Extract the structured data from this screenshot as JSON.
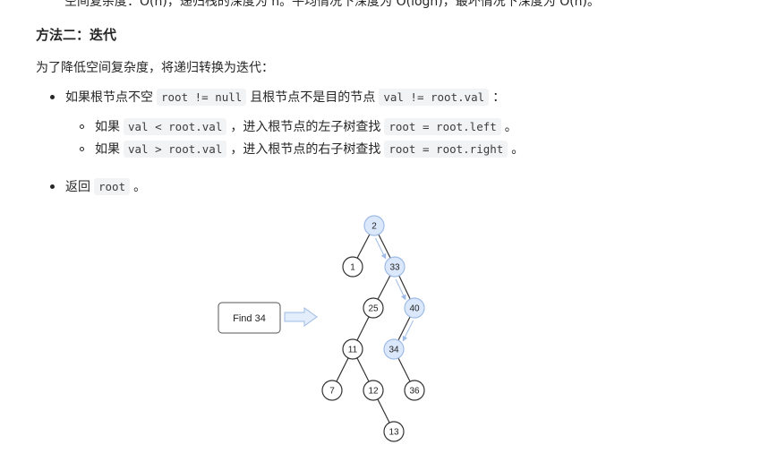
{
  "top_line": "空间复杂度：O(n)，递归栈的深度为 n。平均情况下深度为 O(logn)，最坏情况下深度为 O(n)。",
  "section_title": "方法二：迭代",
  "intro": "为了降低空间复杂度，将递归转换为迭代：",
  "list": {
    "item1": {
      "prefix": "如果根节点不空",
      "code1": "root != null",
      "middle": "且根节点不是目的节点",
      "code2": "val != root.val",
      "suffix": "："
    },
    "sub1": {
      "prefix": "如果",
      "code1": "val < root.val",
      "middle": "，进入根节点的左子树查找",
      "code2": "root = root.left",
      "suffix": "。"
    },
    "sub2": {
      "prefix": "如果",
      "code1": "val > root.val",
      "middle": "，进入根节点的右子树查找",
      "code2": "root = root.right",
      "suffix": "。"
    },
    "item2": {
      "prefix": "返回",
      "code1": "root",
      "suffix": "。"
    }
  },
  "diagram": {
    "find_label": "Find 34",
    "highlight_color": "#dbe8fb",
    "highlight_stroke": "#9fbbe6",
    "node_stroke": "#333333",
    "nodes": [
      {
        "id": "n2",
        "label": "2",
        "highlighted": true
      },
      {
        "id": "n1",
        "label": "1",
        "highlighted": false
      },
      {
        "id": "n33",
        "label": "33",
        "highlighted": true
      },
      {
        "id": "n25",
        "label": "25",
        "highlighted": false
      },
      {
        "id": "n40",
        "label": "40",
        "highlighted": true
      },
      {
        "id": "n11",
        "label": "11",
        "highlighted": false
      },
      {
        "id": "n34",
        "label": "34",
        "highlighted": true
      },
      {
        "id": "n7",
        "label": "7",
        "highlighted": false
      },
      {
        "id": "n12",
        "label": "12",
        "highlighted": false
      },
      {
        "id": "n36",
        "label": "36",
        "highlighted": false
      },
      {
        "id": "n13",
        "label": "13",
        "highlighted": false
      }
    ],
    "edges": [
      [
        "n2",
        "n1"
      ],
      [
        "n2",
        "n33"
      ],
      [
        "n33",
        "n25"
      ],
      [
        "n33",
        "n40"
      ],
      [
        "n25",
        "n11"
      ],
      [
        "n40",
        "n34"
      ],
      [
        "n11",
        "n7"
      ],
      [
        "n11",
        "n12"
      ],
      [
        "n34",
        "n36"
      ],
      [
        "n12",
        "n13"
      ]
    ],
    "search_path": [
      [
        "n2",
        "n33"
      ],
      [
        "n33",
        "n40"
      ],
      [
        "n40",
        "n34"
      ]
    ]
  }
}
